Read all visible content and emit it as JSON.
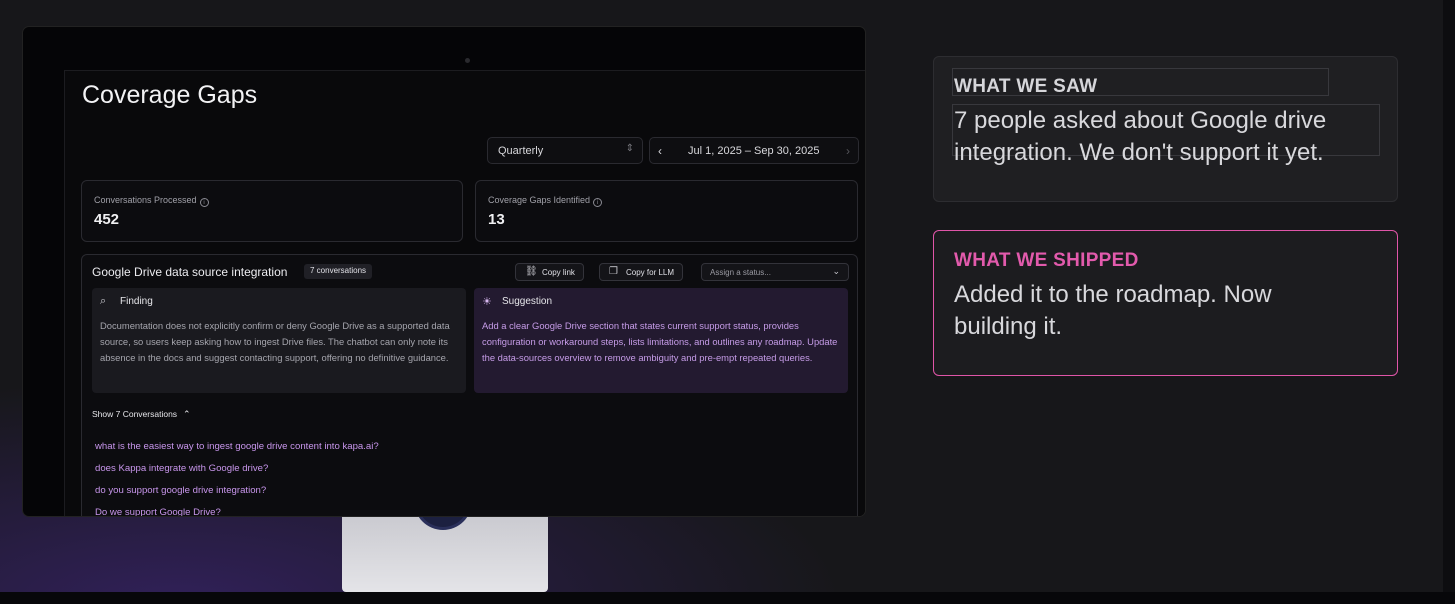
{
  "app": {
    "title": "Coverage Gaps",
    "period_select": "Quarterly",
    "date_range": "Jul 1, 2025 – Sep 30, 2025"
  },
  "stats": [
    {
      "label": "Conversations Processed",
      "value": "452"
    },
    {
      "label": "Coverage Gaps Identified",
      "value": "13"
    }
  ],
  "gap": {
    "title": "Google Drive data source integration",
    "badge": "7 conversations",
    "copy_link": "Copy link",
    "copy_llm": "Copy for LLM",
    "status_placeholder": "Assign a status...",
    "finding_label": "Finding",
    "finding_text": "Documentation does not explicitly confirm or deny Google Drive as a supported data source, so users keep asking how to ingest Drive files. The chatbot can only note its absence in the docs and suggest contacting support, offering no definitive guidance.",
    "suggestion_label": "Suggestion",
    "suggestion_text": "Add a clear Google Drive section that states current support status, provides configuration or workaround steps, lists limitations, and outlines any roadmap. Update the data-sources overview to remove ambiguity and pre-empt repeated queries.",
    "show_conversations": "Show 7 Conversations",
    "conversations": [
      "what is the easiest way to ingest google drive content into kapa.ai?",
      "does Kappa integrate with Google drive?",
      "do you support google drive integration?",
      "Do we support Google Drive?"
    ]
  },
  "icons": {
    "info": "info-icon",
    "search": "search-icon",
    "lightbulb": "lightbulb-icon",
    "link": "link-icon",
    "copy": "copy-icon"
  },
  "cards": {
    "saw_label": "WHAT WE SAW",
    "saw_text": "7 people asked about Google drive integration. We don't support it yet.",
    "shipped_label": "WHAT WE SHIPPED",
    "shipped_text": "Added it to the roadmap. Now building it."
  },
  "colors": {
    "accent_pink": "#e25aac",
    "suggestion_text": "#c69ce8",
    "conversation_link": "#c896ec"
  }
}
